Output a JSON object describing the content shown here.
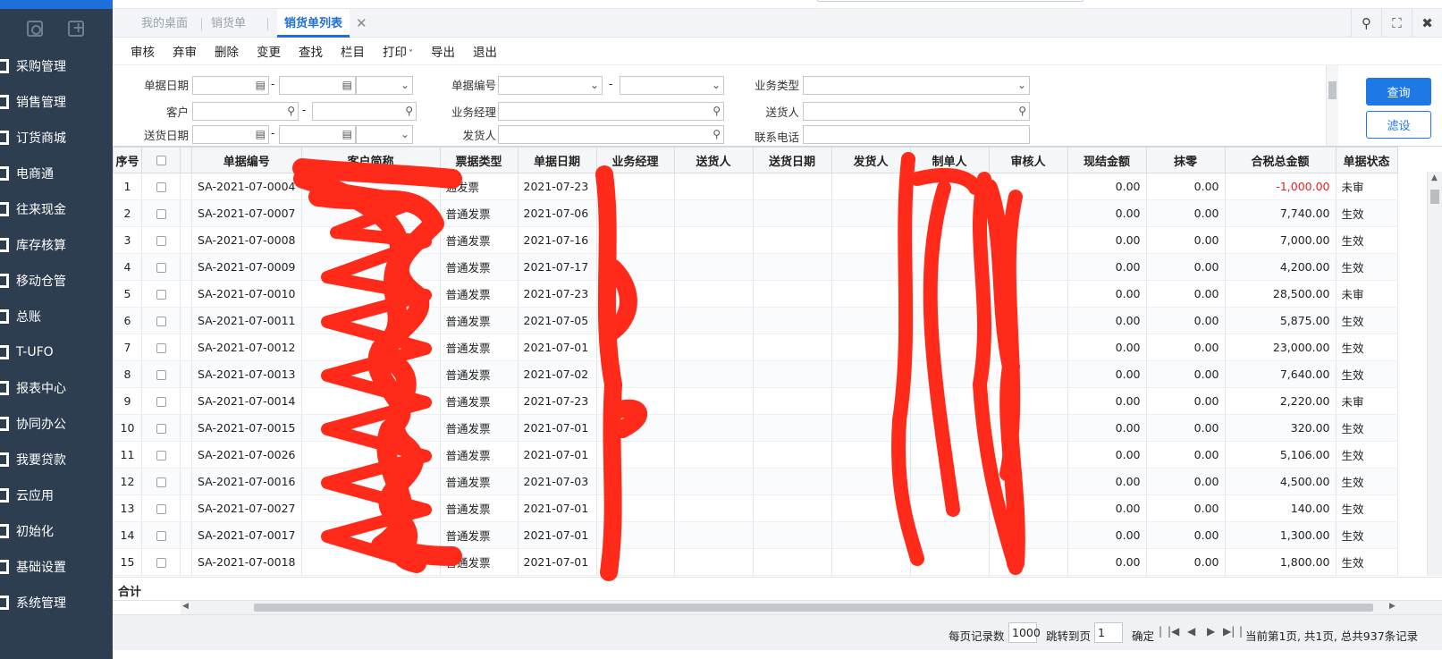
{
  "sidebar": {
    "menu": [
      "采购管理",
      "销售管理",
      "订货商城",
      "电商通",
      "往来现金",
      "库存核算",
      "移动仓管",
      "总账",
      "T-UFO",
      "报表中心",
      "协同办公",
      "我要贷款",
      "云应用",
      "初始化",
      "基础设置",
      "系统管理"
    ]
  },
  "tabs": [
    {
      "label": "我的桌面"
    },
    {
      "label": "销货单"
    },
    {
      "label": "销货单列表"
    }
  ],
  "toolbar": {
    "buttons": [
      "审核",
      "弃审",
      "删除",
      "变更",
      "查找",
      "栏目",
      "打印",
      "导出",
      "退出"
    ]
  },
  "filter": {
    "doc_date_label": "单据日期",
    "doc_no_label": "单据编号",
    "biz_type_label": "业务类型",
    "customer_label": "客户",
    "manager_label": "业务经理",
    "deliverer_label": "送货人",
    "delivery_date_label": "送货日期",
    "shipper_label": "发货人",
    "phone_label": "联系电话",
    "dash": "-",
    "query_button": "查询",
    "filter_button": "滤设"
  },
  "grid": {
    "columns": [
      "序号",
      "",
      "单据编号",
      "客户简称",
      "票据类型",
      "单据日期",
      "业务经理",
      "送货人",
      "送货日期",
      "发货人",
      "制单人",
      "审核人",
      "现结金额",
      "抹零",
      "合税总金额",
      "单据状态"
    ],
    "rows": [
      {
        "no": "1",
        "code": "SA-2021-07-0004",
        "ticket": "通发票",
        "date": "2021-07-23",
        "cash": "0.00",
        "zero": "0.00",
        "total": "-1,000.00",
        "status": "未审",
        "neg": true
      },
      {
        "no": "2",
        "code": "SA-2021-07-0007",
        "ticket": "普通发票",
        "date": "2021-07-06",
        "cash": "0.00",
        "zero": "0.00",
        "total": "7,740.00",
        "status": "生效"
      },
      {
        "no": "3",
        "code": "SA-2021-07-0008",
        "ticket": "普通发票",
        "date": "2021-07-16",
        "cash": "0.00",
        "zero": "0.00",
        "total": "7,000.00",
        "status": "生效"
      },
      {
        "no": "4",
        "code": "SA-2021-07-0009",
        "ticket": "普通发票",
        "date": "2021-07-17",
        "cash": "0.00",
        "zero": "0.00",
        "total": "4,200.00",
        "status": "生效"
      },
      {
        "no": "5",
        "code": "SA-2021-07-0010",
        "ticket": "普通发票",
        "date": "2021-07-23",
        "cash": "0.00",
        "zero": "0.00",
        "total": "28,500.00",
        "status": "未审"
      },
      {
        "no": "6",
        "code": "SA-2021-07-0011",
        "ticket": "普通发票",
        "date": "2021-07-05",
        "cash": "0.00",
        "zero": "0.00",
        "total": "5,875.00",
        "status": "生效"
      },
      {
        "no": "7",
        "code": "SA-2021-07-0012",
        "ticket": "普通发票",
        "date": "2021-07-01",
        "cash": "0.00",
        "zero": "0.00",
        "total": "23,000.00",
        "status": "生效"
      },
      {
        "no": "8",
        "code": "SA-2021-07-0013",
        "ticket": "普通发票",
        "date": "2021-07-02",
        "cash": "0.00",
        "zero": "0.00",
        "total": "7,640.00",
        "status": "生效"
      },
      {
        "no": "9",
        "code": "SA-2021-07-0014",
        "ticket": "普通发票",
        "date": "2021-07-23",
        "cash": "0.00",
        "zero": "0.00",
        "total": "2,220.00",
        "status": "未审"
      },
      {
        "no": "10",
        "code": "SA-2021-07-0015",
        "ticket": "普通发票",
        "date": "2021-07-01",
        "cash": "0.00",
        "zero": "0.00",
        "total": "320.00",
        "status": "生效"
      },
      {
        "no": "11",
        "code": "SA-2021-07-0026",
        "ticket": "普通发票",
        "date": "2021-07-01",
        "cash": "0.00",
        "zero": "0.00",
        "total": "5,106.00",
        "status": "生效"
      },
      {
        "no": "12",
        "code": "SA-2021-07-0016",
        "ticket": "普通发票",
        "date": "2021-07-03",
        "cash": "0.00",
        "zero": "0.00",
        "total": "4,500.00",
        "status": "生效"
      },
      {
        "no": "13",
        "code": "SA-2021-07-0027",
        "ticket": "普通发票",
        "date": "2021-07-01",
        "cash": "0.00",
        "zero": "0.00",
        "total": "140.00",
        "status": "生效"
      },
      {
        "no": "14",
        "code": "SA-2021-07-0017",
        "ticket": "普通发票",
        "date": "2021-07-01",
        "cash": "0.00",
        "zero": "0.00",
        "total": "1,300.00",
        "status": "生效"
      },
      {
        "no": "15",
        "code": "SA-2021-07-0018",
        "ticket": "普通发票",
        "date": "2021-07-01",
        "cash": "0.00",
        "zero": "0.00",
        "total": "1,800.00",
        "status": "生效"
      }
    ],
    "total_label": "合计"
  },
  "pager": {
    "per_page_label": "每页记录数",
    "per_page_value": "1000",
    "goto_label": "跳转到页",
    "goto_value": "1",
    "confirm_label": "确定",
    "status_text": "当前第1页, 共1页, 总共937条记录"
  },
  "colors": {
    "accent": "#1e78e6",
    "sidebar_bg": "#2d3e50",
    "negative": "#e52020",
    "redaction": "#ff2a1a"
  }
}
